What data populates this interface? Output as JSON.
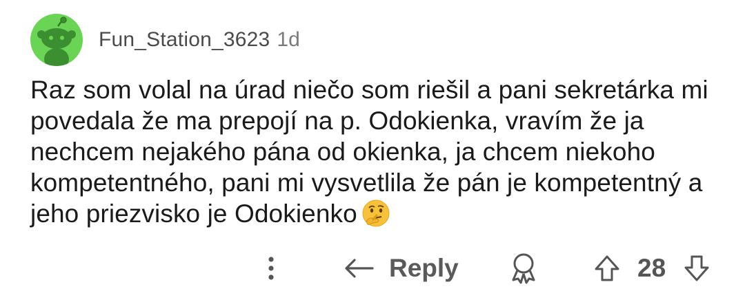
{
  "comment": {
    "author": "Fun_Station_3623",
    "age": "1d",
    "body": "Raz som volal na úrad niečo som riešil a pani sekretárka mi povedala že ma prepojí na p. Odokienka, vravím že ja nechcem nejakého pána od okienka, ja chcem niekoho kompetentného, pani mi vysvetlila že pán je kompetentný a jeho priezvisko je Odokienko",
    "emoji": "thinking-face",
    "score": "28"
  },
  "actions": {
    "reply_label": "Reply",
    "more_icon": "more-vertical-icon",
    "reply_icon": "reply-arrow-icon",
    "award_icon": "award-icon",
    "upvote_icon": "upvote-arrow-icon",
    "downvote_icon": "downvote-arrow-icon"
  },
  "colors": {
    "avatar_bg": "#6ad454",
    "text": "#1a1a1b",
    "muted": "#555555"
  }
}
